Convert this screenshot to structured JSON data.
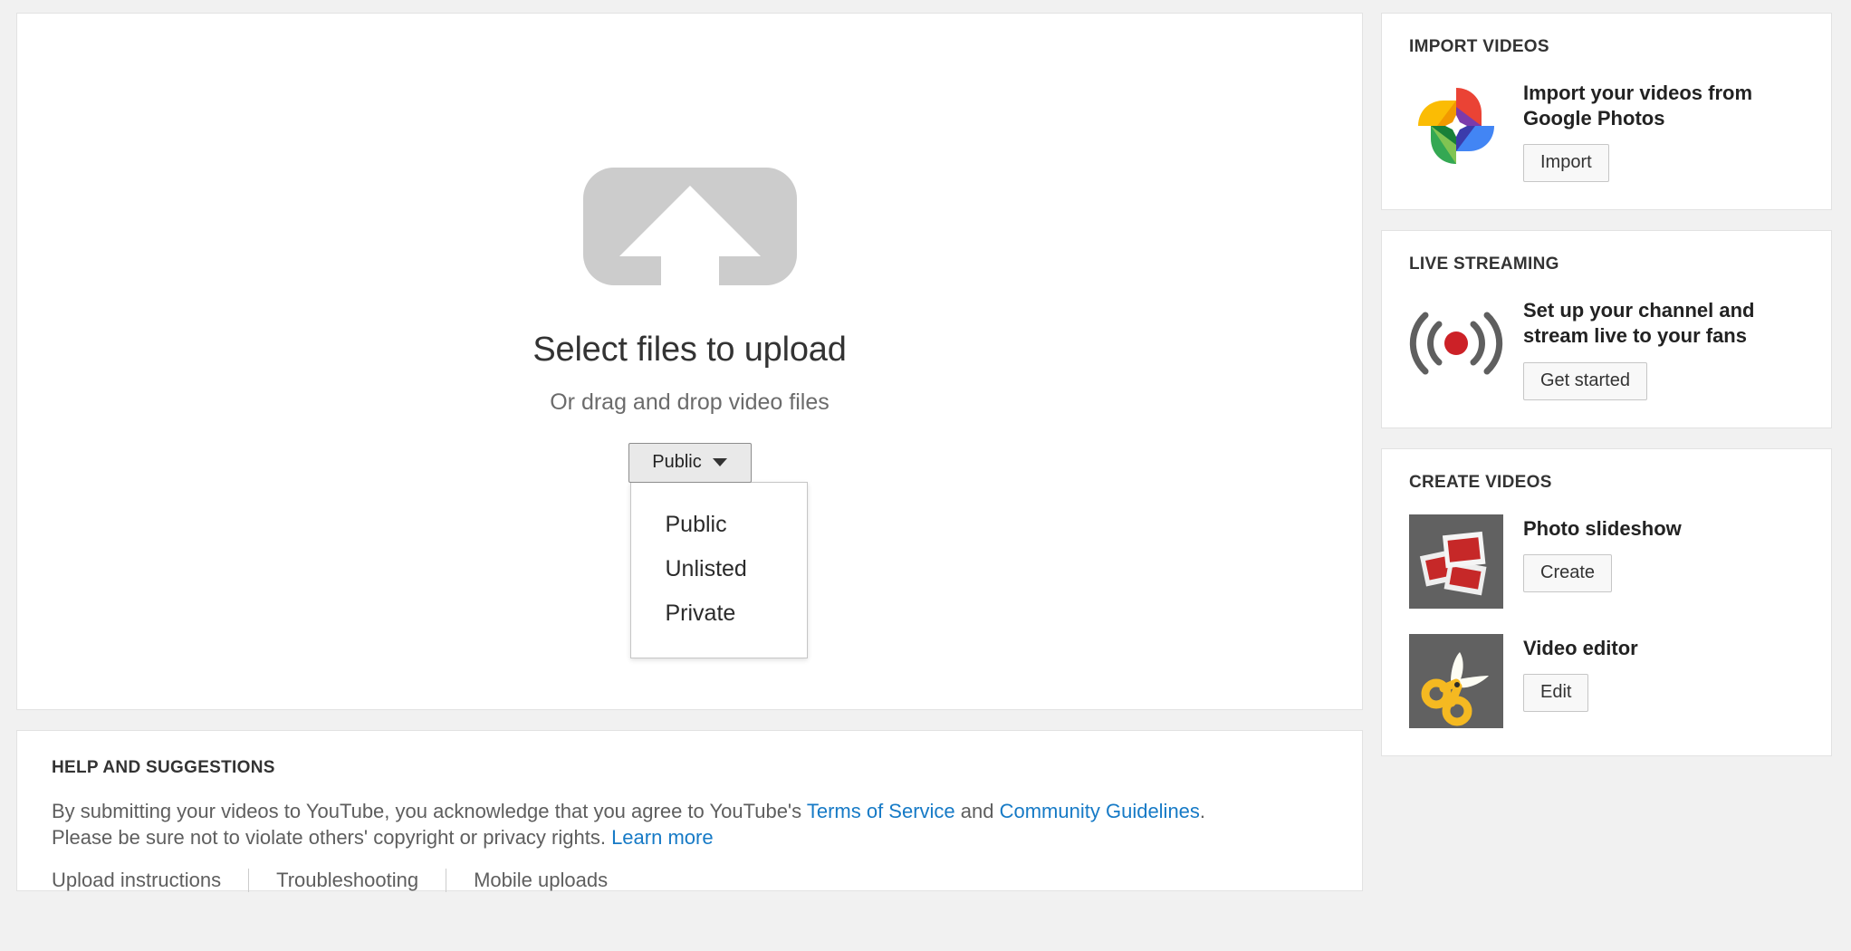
{
  "upload": {
    "icon": "upload-arrow-icon",
    "title": "Select files to upload",
    "subtitle": "Or drag and drop video files",
    "privacy": {
      "selected": "Public",
      "caret_icon": "chevron-down-icon",
      "options": [
        "Public",
        "Unlisted",
        "Private"
      ]
    }
  },
  "help": {
    "title": "HELP AND SUGGESTIONS",
    "line1_pre": "By submitting your videos to YouTube, you acknowledge that you agree to YouTube's ",
    "tos_link": "Terms of Service",
    "line1_mid": " and ",
    "guidelines_link": "Community Guidelines",
    "line1_post": ".",
    "line2_pre": "Please be sure not to violate others' copyright or privacy rights. ",
    "learn_more_link": "Learn more",
    "links": [
      "Upload instructions",
      "Troubleshooting",
      "Mobile uploads"
    ]
  },
  "sidebar": {
    "import": {
      "title": "IMPORT VIDEOS",
      "icon": "google-photos-icon",
      "heading": "Import your videos from Google Photos",
      "button": "Import"
    },
    "live": {
      "title": "LIVE STREAMING",
      "icon": "live-broadcast-icon",
      "heading": "Set up your channel and stream live to your fans",
      "button": "Get started"
    },
    "create": {
      "title": "CREATE VIDEOS",
      "items": [
        {
          "icon": "photo-slideshow-icon",
          "heading": "Photo slideshow",
          "button": "Create"
        },
        {
          "icon": "video-editor-scissors-icon",
          "heading": "Video editor",
          "button": "Edit"
        }
      ]
    }
  },
  "colors": {
    "page_bg": "#f1f1f1",
    "card_bg": "#ffffff",
    "link_blue": "#167ac6",
    "upload_icon_gray": "#cccccc",
    "thumb_bg": "#616161",
    "live_red": "#cc2127",
    "slideshow_red": "#c62828",
    "scissors_yellow": "#f5b921"
  }
}
